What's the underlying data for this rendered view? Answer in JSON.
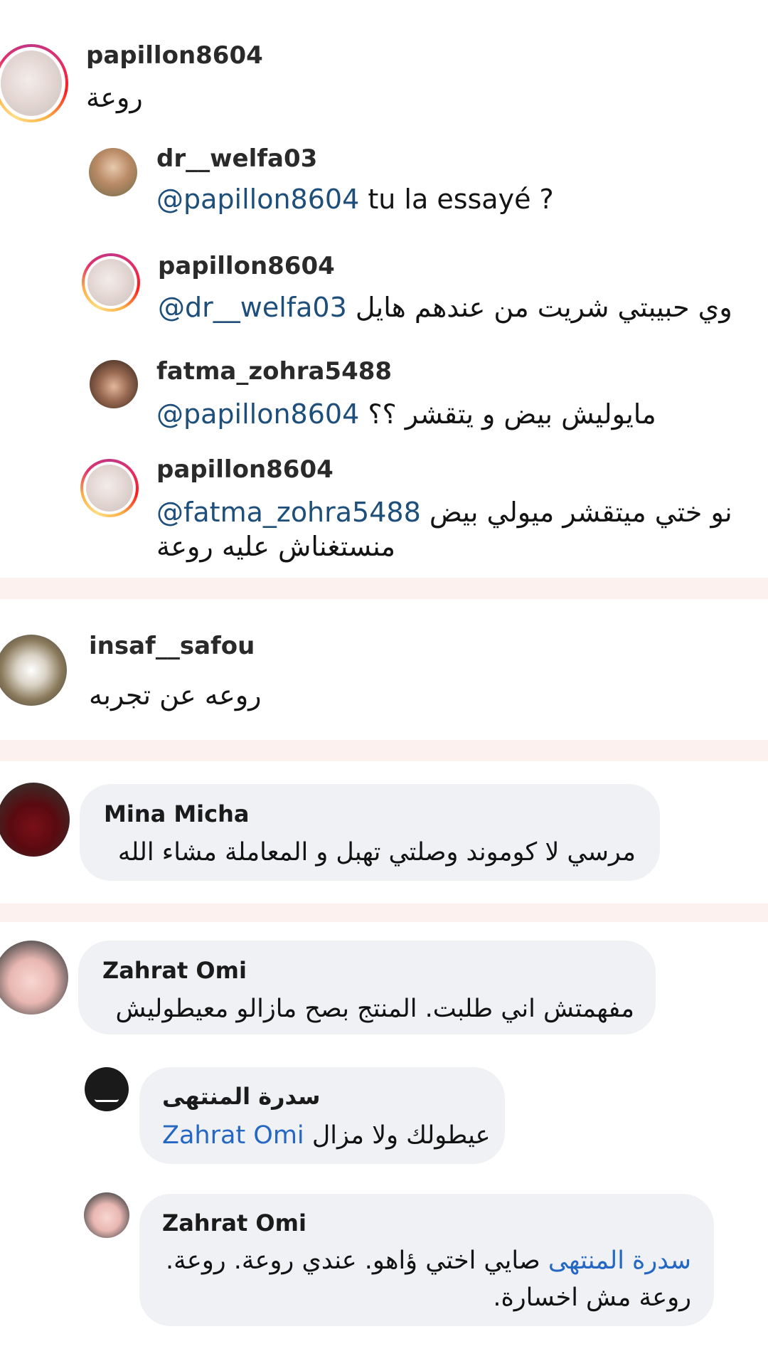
{
  "instagram_comments": {
    "c1": {
      "username": "papillon8604",
      "text": "روعة"
    },
    "r1": {
      "username": "dr__welfa03",
      "mention": "@papillon8604",
      "text": " tu la essayé ?"
    },
    "r2": {
      "username": "papillon8604",
      "mention": "@dr__welfa03",
      "text": "وي حبيبتي شريت من عندهم هايل"
    },
    "r3": {
      "username": "fatma_zohra5488",
      "mention": "@papillon8604",
      "text": "مايوليش بيض و يتقشر ؟؟"
    },
    "r4": {
      "username": "papillon8604",
      "mention": "@fatma_zohra5488",
      "text": "نو ختي ميتقشر ميولي بيض",
      "text_line2": "منستغناش عليه روعة"
    },
    "c2": {
      "username": "insaf__safou",
      "text": "روعه عن تجربه"
    }
  },
  "facebook_comments": {
    "c3": {
      "name": "Mina Micha",
      "text": "مرسي لا كوموند وصلتي تهبل و المعاملة مشاء الله"
    },
    "c4": {
      "name": "Zahrat Omi",
      "text": "مفهمتش اني طلبت. المنتج بصح مازالو معيطوليش"
    },
    "r5": {
      "name": "سدرة المنتهى",
      "tag": "Zahrat Omi",
      "text": "عيطولك ولا مزال"
    },
    "r6": {
      "name": "Zahrat Omi",
      "tag": "سدرة المنتهى",
      "text": "صايي اختي ؤاهو. عندي  روعة. روعة.",
      "text_line2": "روعة مش اخسارة."
    }
  },
  "colors": {
    "mention": "#1e4e7a",
    "fb_link": "#2568c4",
    "bubble": "#eff1f4",
    "divider": "#fdf1f0"
  }
}
